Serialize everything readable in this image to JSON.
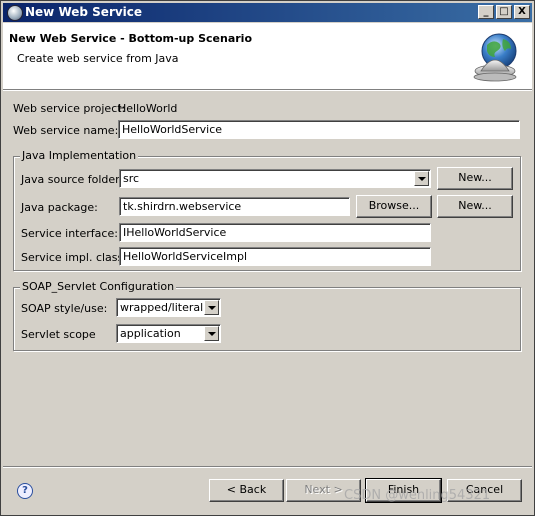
{
  "window": {
    "title": "New Web Service",
    "controls": {
      "minimize": "_",
      "maximize": "□",
      "close": "X"
    }
  },
  "header": {
    "title": "New Web Service - Bottom-up Scenario",
    "description": "Create web service from Java",
    "icon": "globe-bell-icon"
  },
  "form": {
    "project_label": "Web service project:",
    "project_value": "HelloWorld",
    "name_label": "Web service name:",
    "name_value": "HelloWorldService"
  },
  "java_impl": {
    "title": "Java Implementation",
    "source_folder_label": "Java source folder:",
    "source_folder_value": "src",
    "source_new_button": "New...",
    "package_label": "Java package:",
    "package_value": "tk.shirdrn.webservice",
    "browse_button": "Browse...",
    "package_new_button": "New...",
    "interface_label": "Service interface:",
    "interface_value": "IHelloWorldService",
    "impl_label": "Service impl. class:",
    "impl_value": "HelloWorldServiceImpl"
  },
  "soap": {
    "title": "SOAP_Servlet Configuration",
    "style_label": "SOAP style/use:",
    "style_value": "wrapped/literal",
    "scope_label": "Servlet scope",
    "scope_value": "application"
  },
  "footer": {
    "help_icon": "?",
    "back_button": "< Back",
    "next_button": "Next >",
    "finish_button": "Finish",
    "cancel_button": "Cancel"
  },
  "watermark": "CSDN @wenling54321"
}
